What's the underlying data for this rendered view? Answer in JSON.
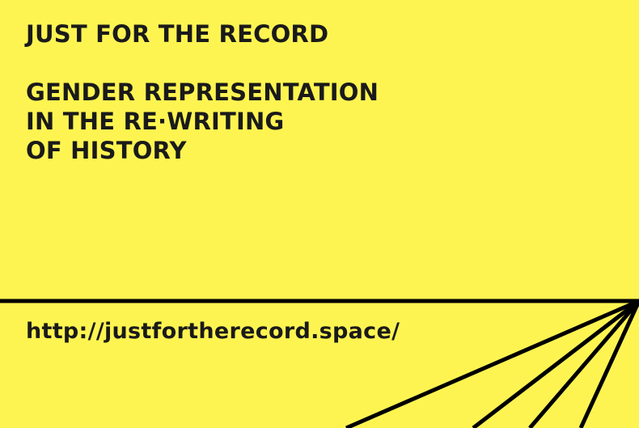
{
  "poster": {
    "title": "JUST FOR THE RECORD",
    "subtitle_lines": [
      "GENDER REPRESENTATION",
      "IN THE RE·WRITING",
      "OF HISTORY"
    ],
    "url": "http://justfortherecord.space/"
  },
  "colors": {
    "background": "#fef451",
    "text": "#1a1a1a",
    "lines": "#000000"
  }
}
